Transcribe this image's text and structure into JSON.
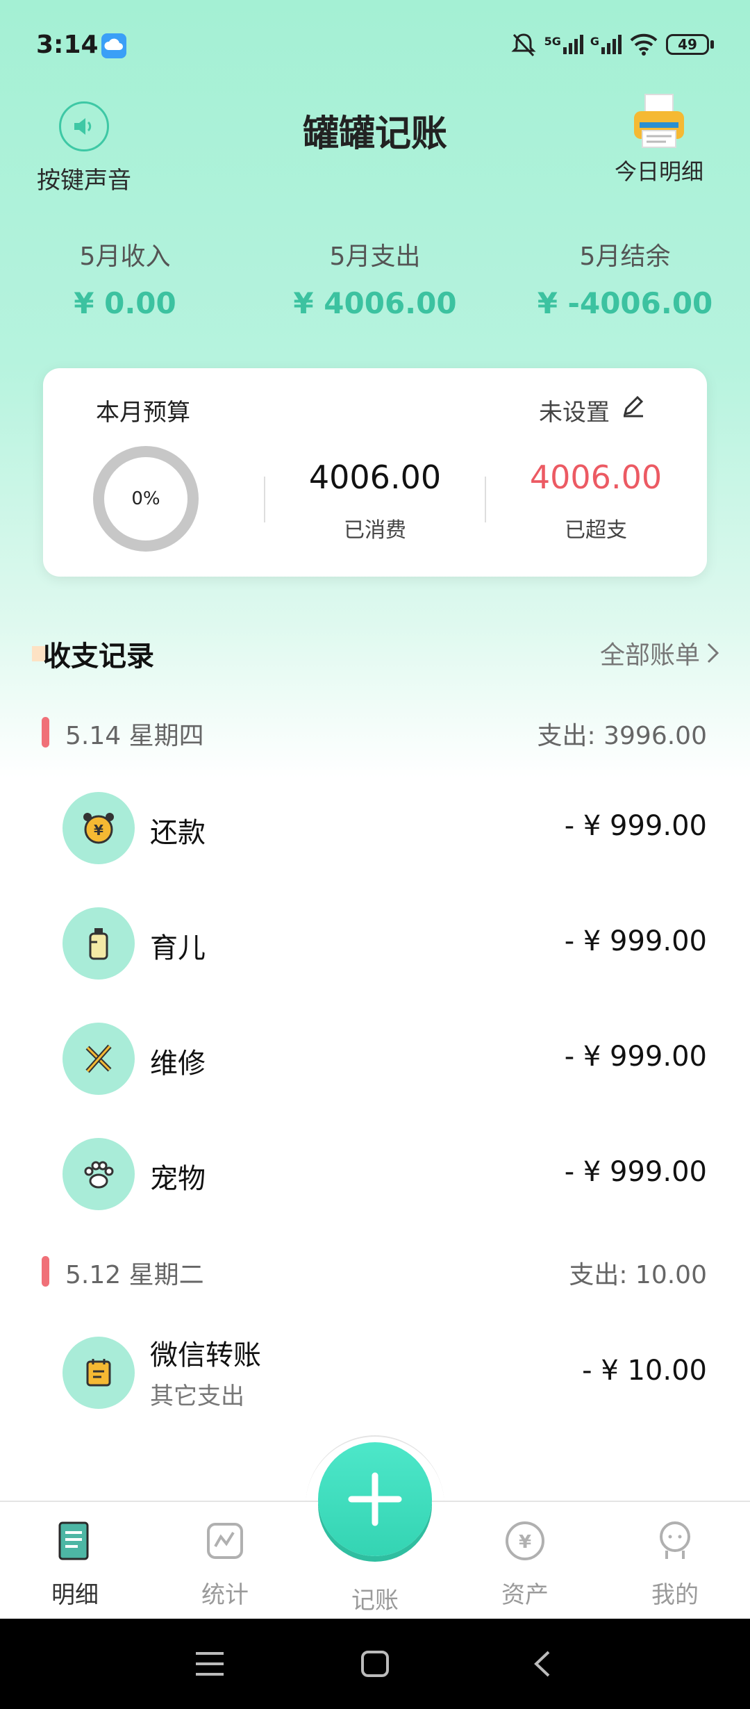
{
  "status_bar": {
    "time": "3:14",
    "battery": "49",
    "signal_labels": [
      "5G",
      "G"
    ]
  },
  "header": {
    "sound_label": "按键声音",
    "title": "罐罐记账",
    "today_label": "今日明细"
  },
  "summary": [
    {
      "label": "5月收入",
      "value": "¥ 0.00"
    },
    {
      "label": "5月支出",
      "value": "¥ 4006.00"
    },
    {
      "label": "5月结余",
      "value": "¥ -4006.00"
    }
  ],
  "budget": {
    "title": "本月预算",
    "status": "未设置",
    "percent_label": "0%",
    "spent_value": "4006.00",
    "spent_label": "已消费",
    "over_value": "4006.00",
    "over_label": "已超支"
  },
  "records": {
    "title": "收支记录",
    "all_label": "全部账单",
    "groups": [
      {
        "date": "5.14 星期四",
        "total": "支出: 3996.00",
        "items": [
          {
            "name": "还款",
            "amount": "- ¥ 999.00",
            "icon": "alarm-coin-icon"
          },
          {
            "name": "育儿",
            "amount": "- ¥ 999.00",
            "icon": "baby-bottle-icon"
          },
          {
            "name": "维修",
            "amount": "- ¥ 999.00",
            "icon": "tools-icon"
          },
          {
            "name": "宠物",
            "amount": "- ¥ 999.00",
            "icon": "paw-icon"
          }
        ]
      },
      {
        "date": "5.12 星期二",
        "total": "支出: 10.00",
        "items": [
          {
            "name": "微信转账",
            "sub": "其它支出",
            "amount": "- ¥ 10.00",
            "icon": "note-icon"
          }
        ]
      }
    ]
  },
  "nav": {
    "items": [
      {
        "label": "明细",
        "icon": "list-icon",
        "active": true
      },
      {
        "label": "统计",
        "icon": "chart-icon",
        "active": false
      },
      {
        "label": "记账",
        "icon": "plus-icon",
        "active": false
      },
      {
        "label": "资产",
        "icon": "yuan-coin-icon",
        "active": false
      },
      {
        "label": "我的",
        "icon": "user-icon",
        "active": false
      }
    ]
  },
  "colors": {
    "accent": "#3cc2a0",
    "over_budget": "#ec5a63",
    "date_marker": "#f07078",
    "icon_bg": "#a9ecd8"
  }
}
